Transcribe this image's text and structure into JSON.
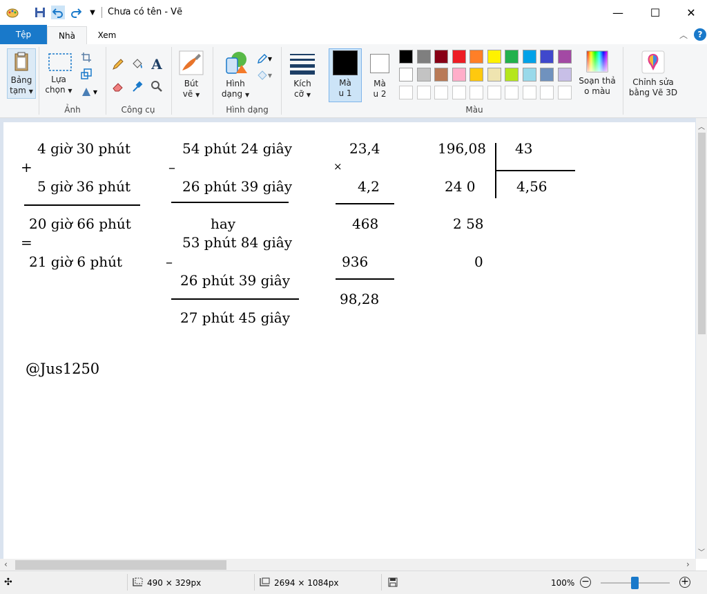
{
  "window": {
    "title": "Chưa có tên - Vẽ"
  },
  "tabs": {
    "file": "Tệp",
    "home": "Nhà",
    "view": "Xem"
  },
  "ribbon": {
    "clipboard": {
      "label_line1": "Bảng",
      "label_line2": "tạm",
      "group": ""
    },
    "image": {
      "select_line1": "Lựa",
      "select_line2": "chọn",
      "group": "Ảnh"
    },
    "tools": {
      "group": "Công cụ"
    },
    "brushes": {
      "line1": "Bút",
      "line2": "vẽ"
    },
    "shapes": {
      "line1": "Hình",
      "line2": "dạng",
      "group": "Hình dạng"
    },
    "size": {
      "line1": "Kích",
      "line2": "cỡ"
    },
    "color1": {
      "line1": "Mà",
      "line2": "u 1"
    },
    "color2": {
      "line1": "Mà",
      "line2": "u 2"
    },
    "colors_group": "Màu",
    "edit_colors": {
      "line1": "Soạn thả",
      "line2": "o màu"
    },
    "paint3d": {
      "line1": "Chỉnh sửa",
      "line2": "bằng Vẽ 3D"
    },
    "palette_row1": [
      "#000000",
      "#7f7f7f",
      "#880015",
      "#ed1c24",
      "#ff7f27",
      "#fff200",
      "#22b14c",
      "#00a2e8",
      "#3f48cc",
      "#a349a4"
    ],
    "palette_row2": [
      "#ffffff",
      "#c3c3c3",
      "#b97a57",
      "#ffaec9",
      "#ffc90e",
      "#efe4b0",
      "#b5e61d",
      "#99d9ea",
      "#7092be",
      "#c8bfe7"
    ],
    "color1_value": "#000000",
    "color2_value": "#ffffff"
  },
  "canvas": {
    "add": {
      "a": "4 giờ 30 phút",
      "op": "+",
      "b": "5 giờ 36 phút",
      "r1": "20 giờ 66 phút",
      "eq": "=",
      "r2": "21 giờ 6 phút"
    },
    "sub": {
      "a": "54 phút 24 giây",
      "op1": "–",
      "b": "26 phút 39 giây",
      "hay": "hay",
      "c": "53 phút 84 giây",
      "op2": "–",
      "d": "26 phút 39 giây",
      "r": "27 phút 45 giây"
    },
    "mul": {
      "a": "23,4",
      "op": "×",
      "b": "4,2",
      "p1": "468",
      "p2": "936",
      "r": "98,28"
    },
    "div": {
      "dividend": "196,08",
      "divisor": "43",
      "s1": "24 0",
      "quotient": "4,56",
      "s2": "2 58",
      "s3": "0"
    },
    "signature": "@Jus1250"
  },
  "status": {
    "selection_size": "490 × 329px",
    "canvas_size": "2694 × 1084px",
    "zoom": "100%"
  }
}
